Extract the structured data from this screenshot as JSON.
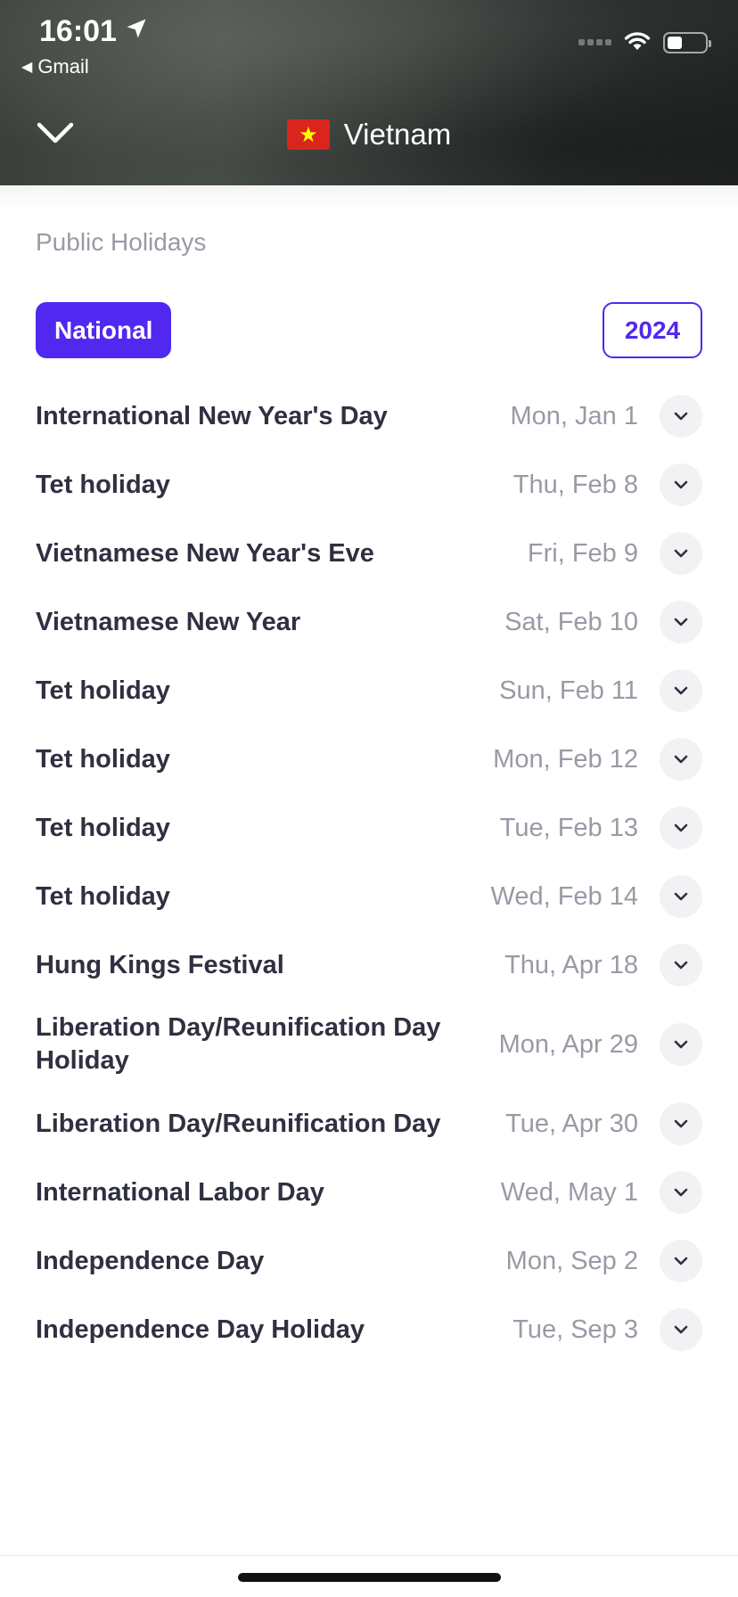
{
  "status_bar": {
    "time": "16:01",
    "back_app": "Gmail"
  },
  "header": {
    "title": "Vietnam",
    "flag_colors": {
      "background": "#da251d",
      "star": "#ffff00"
    }
  },
  "section": {
    "title": "Public Holidays"
  },
  "filters": {
    "type_label": "National",
    "year_label": "2024"
  },
  "accent_color": "#5128ef",
  "holidays": [
    {
      "name": "International New Year's Day",
      "date": "Mon, Jan 1"
    },
    {
      "name": "Tet holiday",
      "date": "Thu, Feb 8"
    },
    {
      "name": "Vietnamese New Year's Eve",
      "date": "Fri, Feb 9"
    },
    {
      "name": "Vietnamese New Year",
      "date": "Sat, Feb 10"
    },
    {
      "name": "Tet holiday",
      "date": "Sun, Feb 11"
    },
    {
      "name": "Tet holiday",
      "date": "Mon, Feb 12"
    },
    {
      "name": "Tet holiday",
      "date": "Tue, Feb 13"
    },
    {
      "name": "Tet holiday",
      "date": "Wed, Feb 14"
    },
    {
      "name": "Hung Kings Festival",
      "date": "Thu, Apr 18"
    },
    {
      "name": "Liberation Day/Reunification Day Holiday",
      "date": "Mon, Apr 29"
    },
    {
      "name": "Liberation Day/Reunification Day",
      "date": "Tue, Apr 30"
    },
    {
      "name": "International Labor Day",
      "date": "Wed, May 1"
    },
    {
      "name": "Independence Day",
      "date": "Mon, Sep 2"
    },
    {
      "name": "Independence Day Holiday",
      "date": "Tue, Sep 3"
    }
  ]
}
